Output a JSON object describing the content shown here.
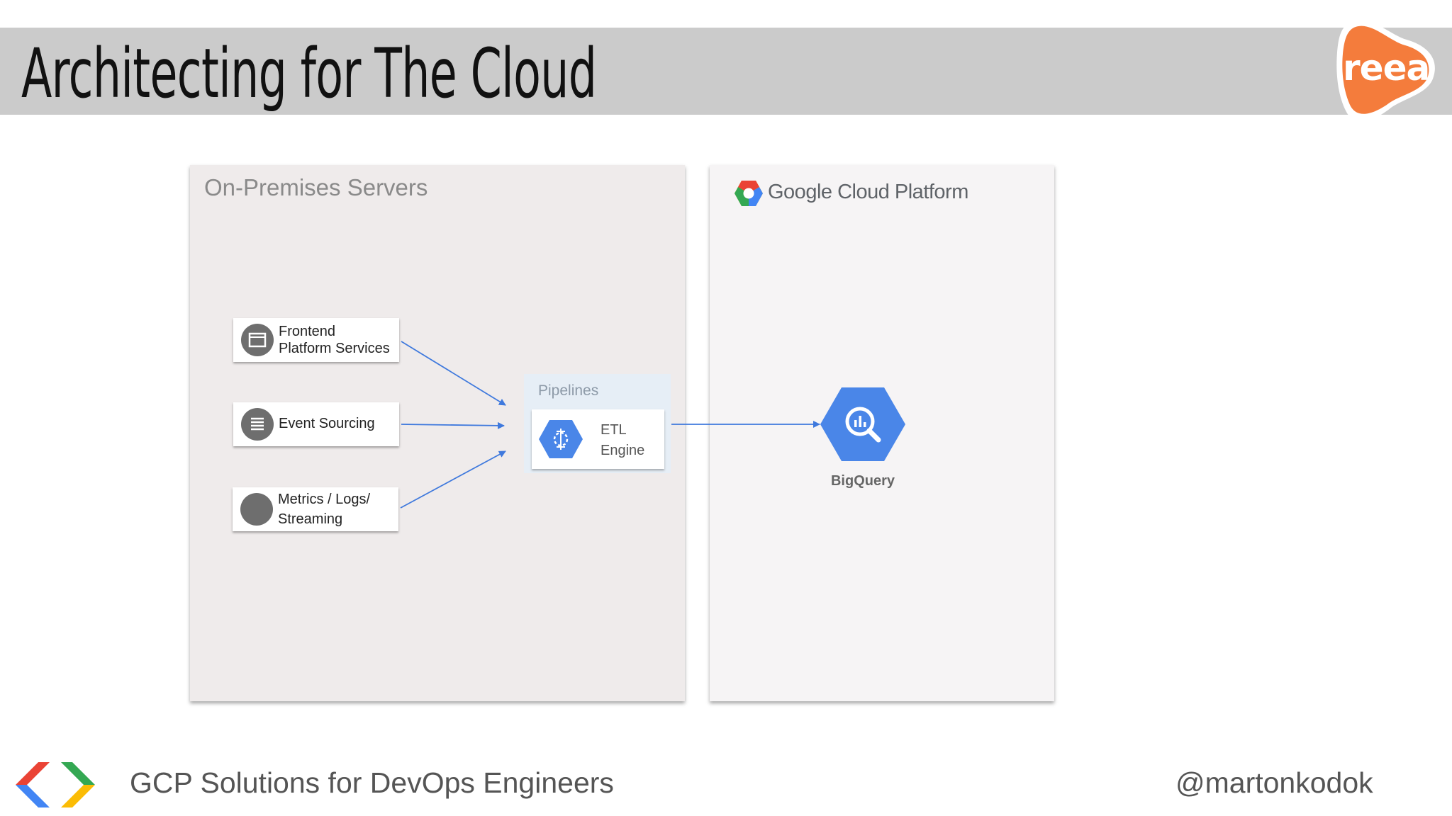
{
  "header": {
    "title": "Architecting for The Cloud",
    "logo_text": "reea",
    "logo_color": "#f47c3c"
  },
  "onprem": {
    "title": "On-Premises Servers",
    "services": [
      {
        "line1": "Frontend",
        "line2": "Platform Services",
        "icon": "browser-window-icon"
      },
      {
        "line1": "Event Sourcing",
        "line2": "",
        "icon": "list-icon"
      },
      {
        "line1": "Metrics / Logs/",
        "line2": "Streaming",
        "icon": "circle-icon"
      }
    ]
  },
  "gcp": {
    "logo_google": "Google",
    "logo_rest": " Cloud Platform",
    "pipelines_label": "Pipelines",
    "etl": {
      "line1": "ETL",
      "line2": "Engine"
    },
    "bigquery_label": "BigQuery"
  },
  "colors": {
    "accent_blue": "#4a86e8",
    "arrow": "#3f79dd",
    "onprem_bg": "#efebeb",
    "gcp_bg": "#f6f4f5"
  },
  "footer": {
    "left_text": "GCP Solutions for DevOps Engineers",
    "right_text": "@martonkodok"
  }
}
